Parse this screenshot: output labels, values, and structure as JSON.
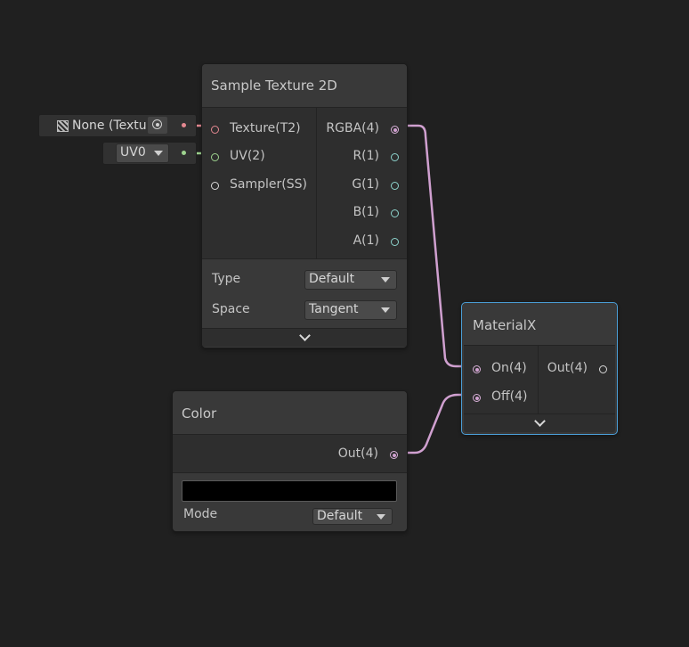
{
  "sample_texture_node": {
    "title": "Sample Texture 2D",
    "inputs": [
      {
        "label": "Texture(T2)"
      },
      {
        "label": "UV(2)"
      },
      {
        "label": "Sampler(SS)"
      }
    ],
    "outputs": [
      {
        "label": "RGBA(4)"
      },
      {
        "label": "R(1)"
      },
      {
        "label": "G(1)"
      },
      {
        "label": "B(1)"
      },
      {
        "label": "A(1)"
      }
    ],
    "type_label": "Type",
    "type_value": "Default",
    "space_label": "Space",
    "space_value": "Tangent",
    "texture_field_value": "None (Textu",
    "uv_field_value": "UV0"
  },
  "materialx_node": {
    "title": "MaterialX",
    "inputs": [
      {
        "label": "On(4)"
      },
      {
        "label": "Off(4)"
      }
    ],
    "outputs": [
      {
        "label": "Out(4)"
      }
    ],
    "selected_color": "#4a9ed6"
  },
  "color_node": {
    "title": "Color",
    "outputs": [
      {
        "label": "Out(4)"
      }
    ],
    "swatch_color": "#000000",
    "mode_label": "Mode",
    "mode_value": "Default"
  },
  "colors": {
    "background": "#202020",
    "texture_wire": "#e48891",
    "uv_wire": "#9ed38f",
    "vector4_wire": "#d0a0d0"
  }
}
